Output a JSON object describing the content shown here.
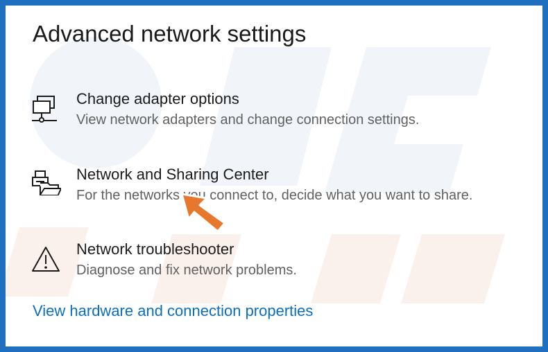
{
  "title": "Advanced network settings",
  "options": [
    {
      "title": "Change adapter options",
      "description": "View network adapters and change connection settings.",
      "icon": "network-adapter-icon"
    },
    {
      "title": "Network and Sharing Center",
      "description": "For the networks you connect to, decide what you want to share.",
      "icon": "network-sharing-icon"
    },
    {
      "title": "Network troubleshooter",
      "description": "Diagnose and fix network problems.",
      "icon": "warning-icon"
    }
  ],
  "link": "View hardware and connection properties",
  "colors": {
    "frame": "#1f6fc0",
    "link": "#0a6ec2",
    "arrow": "#e8772e"
  },
  "overlay_icon": "pointer-arrow-icon"
}
